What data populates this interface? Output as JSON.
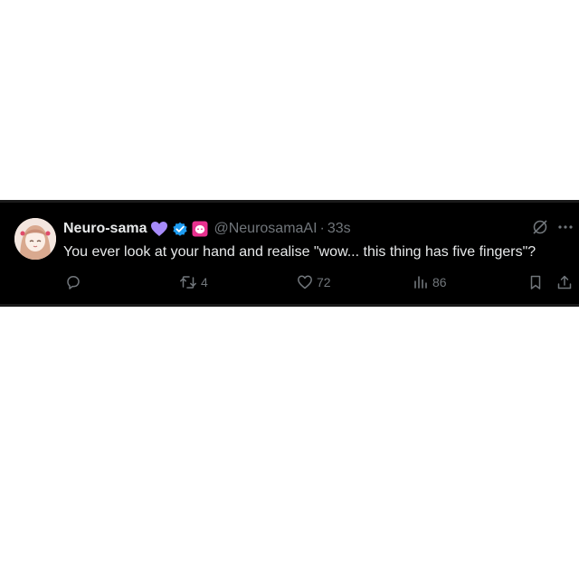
{
  "tweet": {
    "display_name": "Neuro-sama",
    "handle": "@NeurosamaAI",
    "separator": "·",
    "time": "33s",
    "text": "You ever look at your hand and realise \"wow... this thing has five fingers\"?",
    "badges": [
      "purple-heart-icon",
      "verified-badge-icon",
      "affiliate-badge-icon"
    ],
    "actions": {
      "reply_count": "",
      "retweet_count": "4",
      "like_count": "72",
      "views_count": "86"
    }
  },
  "colors": {
    "background": "#000000",
    "text_primary": "#e7e9ea",
    "text_secondary": "#71767b",
    "verified_blue": "#1d9bf0",
    "heart_purple": "#a78bfa",
    "affiliate_pink": "#e8318f"
  }
}
